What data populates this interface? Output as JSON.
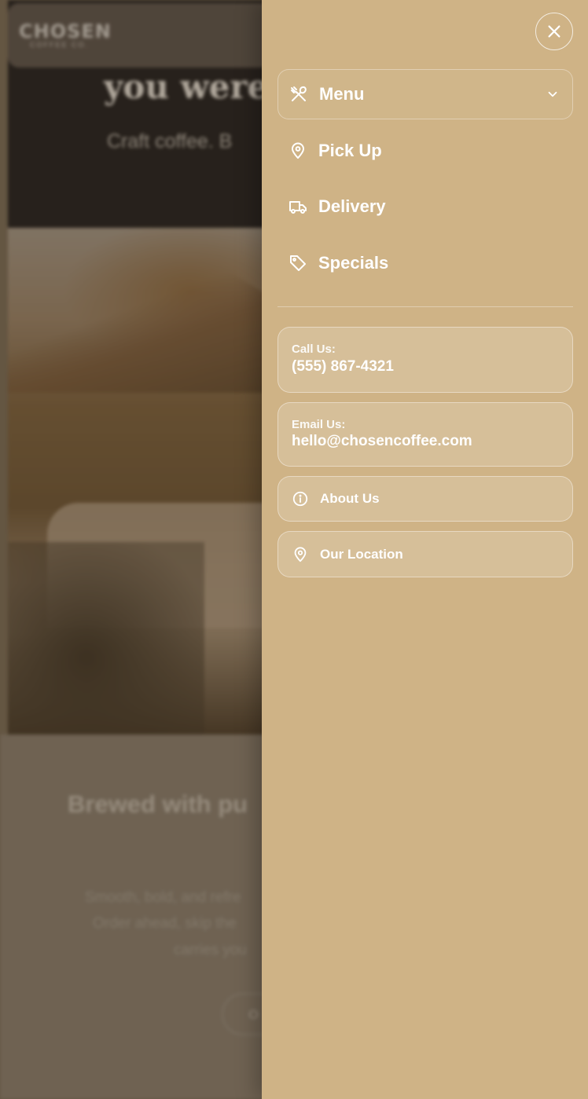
{
  "background": {
    "logo_main": "CHOSEN",
    "logo_sub": "COFFEE CO.",
    "headline": "you were",
    "tagline": "Craft coffee. B",
    "section_title": "Brewed with pu",
    "para_lines": [
      "Smooth, bold, and refre",
      "Order ahead, skip the",
      "carries you"
    ],
    "button_label": "O"
  },
  "drawer": {
    "close_icon": "close-icon",
    "nav": [
      {
        "label": "Menu",
        "icon": "utensils-icon",
        "has_dropdown": true
      },
      {
        "label": "Pick Up",
        "icon": "location-pin-icon"
      },
      {
        "label": "Delivery",
        "icon": "truck-icon"
      },
      {
        "label": "Specials",
        "icon": "tag-icon"
      }
    ],
    "call": {
      "label": "Call Us:",
      "value": "(555) 867-4321"
    },
    "email": {
      "label": "Email Us:",
      "value": "hello@chosencoffee.com"
    },
    "about": {
      "label": "About Us",
      "icon": "info-icon"
    },
    "location": {
      "label": "Our Location",
      "icon": "location-pin-icon"
    }
  },
  "colors": {
    "drawer_bg": "#cfb386",
    "text": "#ffffff"
  }
}
